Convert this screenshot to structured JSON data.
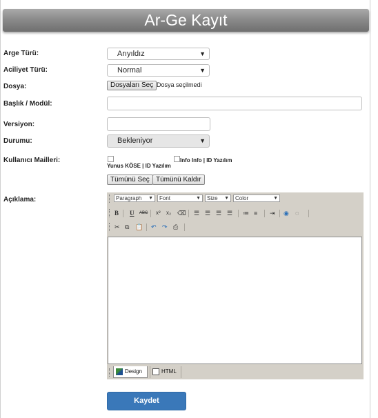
{
  "header": {
    "title": "Ar-Ge Kayıt"
  },
  "form": {
    "arge_turu": {
      "label": "Arge Türü:",
      "value": "Arıyıldız"
    },
    "aciliyet": {
      "label": "Aciliyet Türü:",
      "value": "Normal"
    },
    "dosya": {
      "label": "Dosya:",
      "button": "Dosyaları Seç",
      "status": "Dosya seçilmedi"
    },
    "baslik": {
      "label": "Başlık / Modül:",
      "value": ""
    },
    "versiyon": {
      "label": "Versiyon:",
      "value": ""
    },
    "durum": {
      "label": "Durumu:",
      "value": "Bekleniyor"
    },
    "mailler": {
      "label": "Kullanıcı Mailleri:",
      "users": [
        {
          "name": "Yunus KÖSE",
          "company": "ID Yazılım"
        },
        {
          "name": "Info Info",
          "company": "ID Yazılım"
        }
      ],
      "select_all": "Tümünü Seç",
      "deselect_all": "Tümünü Kaldır"
    },
    "aciklama": {
      "label": "Açıklama:"
    }
  },
  "editor": {
    "dropdowns": {
      "paragraph": "Paragraph",
      "font": "Font",
      "size": "Size",
      "color": "Color"
    },
    "tabs": {
      "design": "Design",
      "html": "HTML"
    }
  },
  "footer": {
    "save_label": "Kaydet"
  }
}
